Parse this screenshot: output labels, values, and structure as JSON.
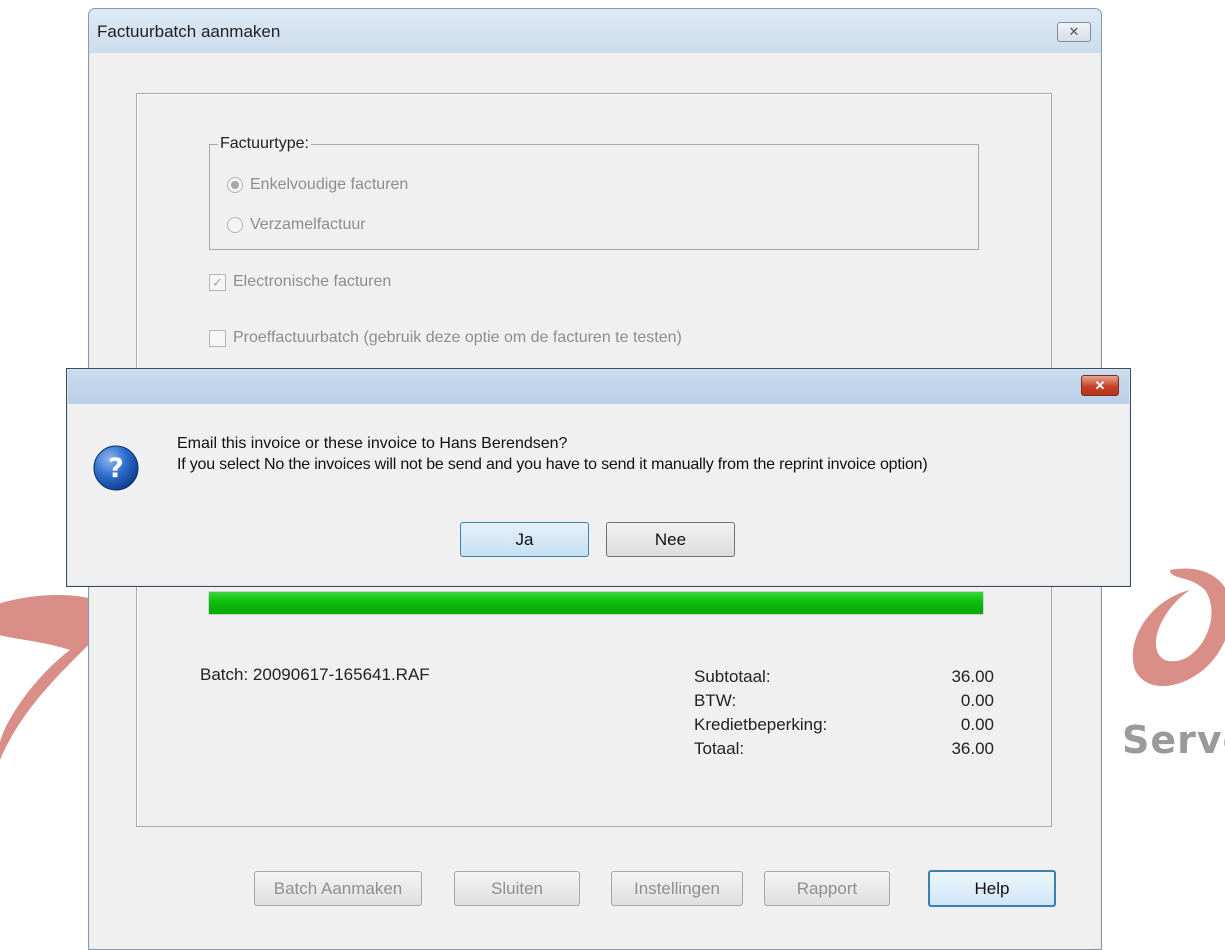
{
  "main_window": {
    "title": "Factuurbatch aanmaken",
    "close_glyph": "✕",
    "factuurtype": {
      "legend": "Factuurtype:",
      "options": [
        {
          "label": "Enkelvoudige facturen",
          "selected": true
        },
        {
          "label": "Verzamelfactuur",
          "selected": false
        }
      ]
    },
    "electronisch": {
      "label": "Electronische facturen",
      "checked": true
    },
    "proef": {
      "label": "Proeffactuurbatch (gebruik deze optie om de facturen te testen)",
      "checked": false
    },
    "progress": 1.0,
    "batch_label": "Batch: 20090617-165641.RAF",
    "summary": [
      {
        "label": "Subtotaal:",
        "value": "36.00"
      },
      {
        "label": "BTW:",
        "value": "0.00"
      },
      {
        "label": "Kredietbeperking:",
        "value": "0.00"
      },
      {
        "label": "Totaal:",
        "value": "36.00"
      }
    ],
    "buttons": {
      "batch": "Batch Aanmaken",
      "sluiten": "Sluiten",
      "instellingen": "Instellingen",
      "rapport": "Rapport",
      "help": "Help"
    }
  },
  "message_box": {
    "close_glyph": "✕",
    "line1": "Email this invoice or these invoice to Hans Berendsen?",
    "line2": "If you select No the invoices will not be send and you have to send it manually from the reprint invoice option)",
    "yes": "Ja",
    "no": "Nee",
    "icon": "question-icon"
  },
  "watermark": {
    "text": "Server"
  },
  "colors": {
    "progress": "#0cbd0c",
    "accent": "#3c7fb1",
    "close_red": "#c7422a"
  }
}
